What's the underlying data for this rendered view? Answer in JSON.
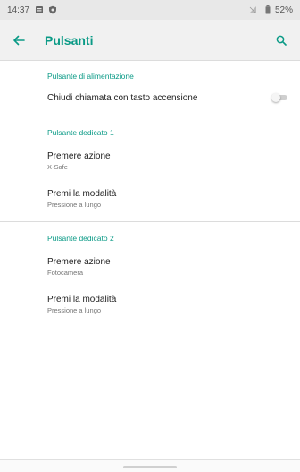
{
  "status_bar": {
    "time": "14:37",
    "battery": "52%"
  },
  "app_bar": {
    "title": "Pulsanti",
    "back_icon": "arrow-left-icon",
    "search_icon": "search-icon"
  },
  "sections": {
    "power": {
      "header": "Pulsante di alimentazione",
      "item": {
        "title": "Chiudi chiamata con tasto accensione",
        "switch_on": false
      }
    },
    "dedicated1": {
      "header": "Pulsante dedicato 1",
      "items": [
        {
          "title": "Premere azione",
          "subtitle": "X-Safe"
        },
        {
          "title": "Premi la modalità",
          "subtitle": "Pressione a lungo"
        }
      ]
    },
    "dedicated2": {
      "header": "Pulsante dedicato 2",
      "items": [
        {
          "title": "Premere azione",
          "subtitle": "Fotocamera"
        },
        {
          "title": "Premi la modalità",
          "subtitle": "Pressione a lungo"
        }
      ]
    }
  },
  "colors": {
    "accent": "#0a9a86",
    "status_bar_bg": "#e8e8e8",
    "app_bar_bg": "#f1f1f1"
  }
}
